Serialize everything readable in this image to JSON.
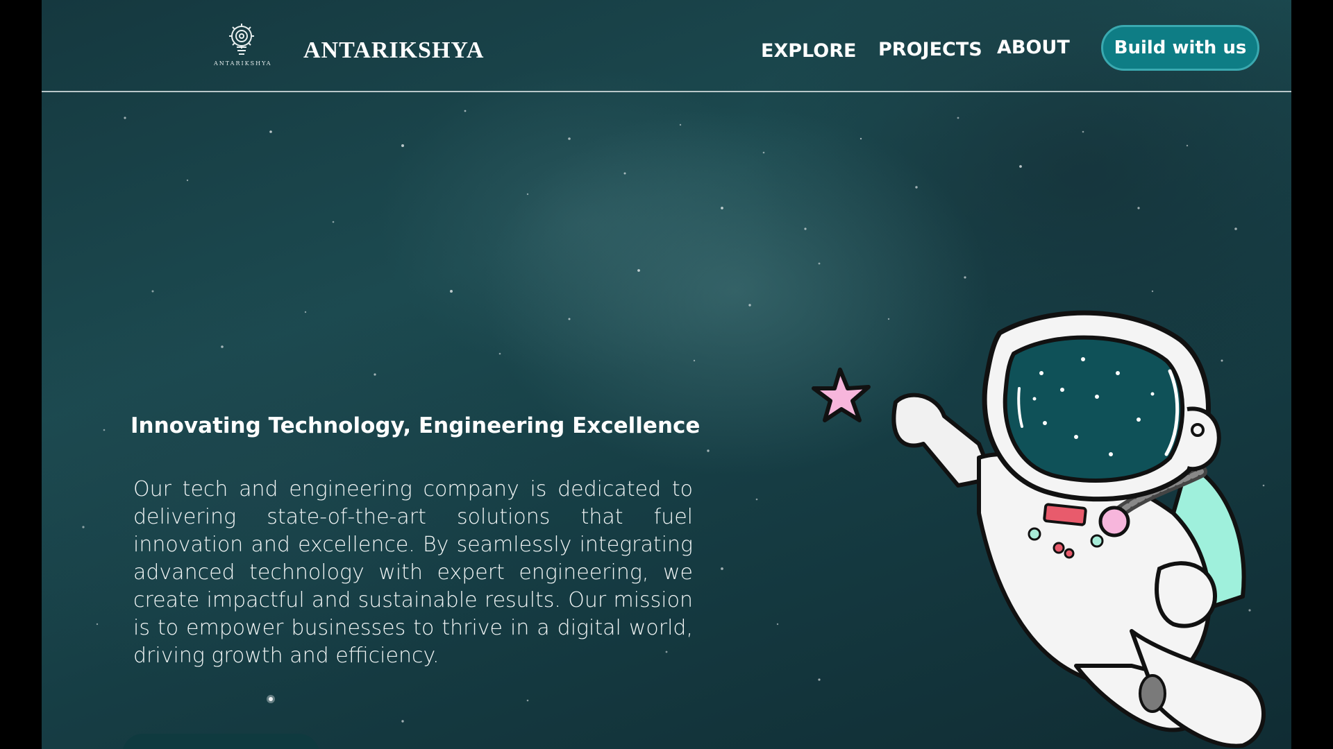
{
  "header": {
    "logo_small_text": "ANTARIKSHYA",
    "brand": "ANTARIKSHYA",
    "nav": {
      "explore": "EXPLORE",
      "projects": "PROJECTS",
      "about": "ABOUT"
    },
    "cta_label": "Build with us"
  },
  "hero": {
    "heading": "Innovating Technology, Engineering Excellence",
    "body": "Our tech and engineering company is dedicated to delivering state-of-the-art solutions that fuel innovation and excellence. By seamlessly integrating advanced technology with expert engineering, we create impactful and sustainable results. Our mission is to empower businesses to thrive in a digital world, driving growth and efficiency."
  },
  "icons": [
    "gear-bulb-logo-icon",
    "star-icon",
    "astronaut-illustration"
  ],
  "colors": {
    "background": "#163d44",
    "accent": "#0e7d85",
    "accent_border": "#3aa9b0",
    "star_pink": "#f7b6dc",
    "backpack_mint": "#9ff0dc",
    "visor": "#0f5158"
  }
}
